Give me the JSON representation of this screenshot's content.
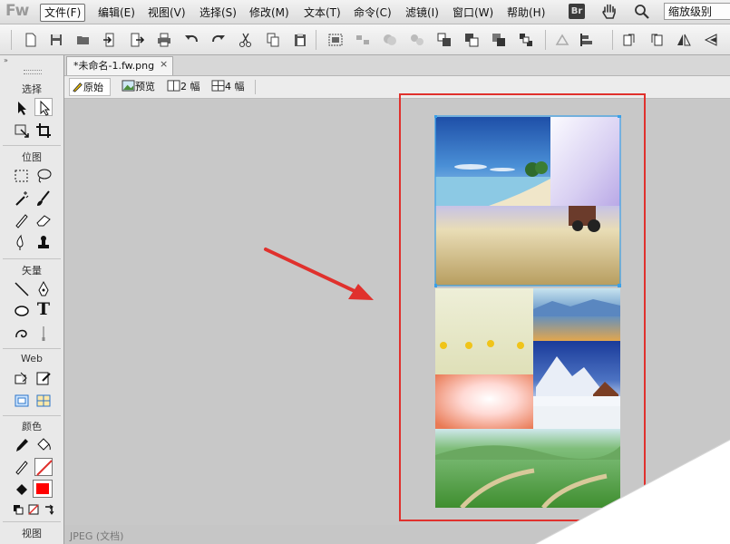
{
  "app": {
    "logo": "Fw"
  },
  "menus": [
    {
      "label": "文件(F)",
      "active": true
    },
    {
      "label": "编辑(E)"
    },
    {
      "label": "视图(V)"
    },
    {
      "label": "选择(S)"
    },
    {
      "label": "修改(M)"
    },
    {
      "label": "文本(T)"
    },
    {
      "label": "命令(C)"
    },
    {
      "label": "滤镜(I)"
    },
    {
      "label": "窗口(W)"
    },
    {
      "label": "帮助(H)"
    }
  ],
  "menubar_right": {
    "bridge_badge": "Br",
    "zoom_select": "缩放级别"
  },
  "tools_panel": {
    "collapse": "»",
    "sections": {
      "select": "选择",
      "bitmap": "位图",
      "vector": "矢量",
      "web": "Web",
      "colors": "颜色",
      "view": "视图"
    },
    "text_tool": "T"
  },
  "document": {
    "tab_title": "*未命名-1.fw.png",
    "close": "×"
  },
  "view_bar": {
    "original": "原始",
    "preview": "预览",
    "two_up": "2 幅",
    "four_up": "4 幅"
  },
  "status": {
    "text": "JPEG (文档)"
  },
  "colors": {
    "accent_red": "#e0312d",
    "selection_blue": "#3aa0e8",
    "fill_red": "#ff0000"
  }
}
